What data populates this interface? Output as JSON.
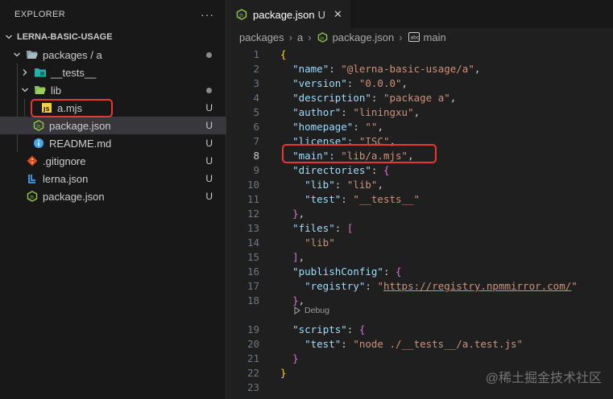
{
  "sidebar": {
    "title": "EXPLORER",
    "more": "···",
    "root": "LERNA-BASIC-USAGE",
    "items": [
      {
        "label": "packages / a",
        "status": ""
      },
      {
        "label": "__tests__",
        "status": ""
      },
      {
        "label": "lib",
        "status": ""
      },
      {
        "label": "a.mjs",
        "status": "U"
      },
      {
        "label": "package.json",
        "status": "U"
      },
      {
        "label": "README.md",
        "status": "U"
      },
      {
        "label": ".gitignore",
        "status": "U"
      },
      {
        "label": "lerna.json",
        "status": "U"
      },
      {
        "label": "package.json",
        "status": "U"
      }
    ]
  },
  "editor": {
    "tab": {
      "name": "package.json",
      "status": "U",
      "close": "✕"
    },
    "breadcrumbs": [
      "packages",
      "a",
      "package.json",
      "main"
    ],
    "codelens": "Debug",
    "active_line": "8",
    "lines": [
      {
        "n": "1",
        "t": "{"
      },
      {
        "n": "2",
        "t": "  \"name\": \"@lerna-basic-usage/a\","
      },
      {
        "n": "3",
        "t": "  \"version\": \"0.0.0\","
      },
      {
        "n": "4",
        "t": "  \"description\": \"package a\","
      },
      {
        "n": "5",
        "t": "  \"author\": \"liningxu\","
      },
      {
        "n": "6",
        "t": "  \"homepage\": \"\","
      },
      {
        "n": "7",
        "t": "  \"license\": \"ISC\","
      },
      {
        "n": "8",
        "t": "  \"main\": \"lib/a.mjs\","
      },
      {
        "n": "9",
        "t": "  \"directories\": {"
      },
      {
        "n": "10",
        "t": "    \"lib\": \"lib\","
      },
      {
        "n": "11",
        "t": "    \"test\": \"__tests__\""
      },
      {
        "n": "12",
        "t": "  },"
      },
      {
        "n": "13",
        "t": "  \"files\": ["
      },
      {
        "n": "14",
        "t": "    \"lib\""
      },
      {
        "n": "15",
        "t": "  ],"
      },
      {
        "n": "16",
        "t": "  \"publishConfig\": {"
      },
      {
        "n": "17",
        "t": "    \"registry\": \"https://registry.npmmirror.com/\""
      },
      {
        "n": "18",
        "t": "  },"
      },
      {
        "n": "19",
        "t": "  \"scripts\": {"
      },
      {
        "n": "20",
        "t": "    \"test\": \"node ./__tests__/a.test.js\""
      },
      {
        "n": "21",
        "t": "  }"
      },
      {
        "n": "22",
        "t": "}"
      },
      {
        "n": "23",
        "t": ""
      }
    ]
  },
  "watermark": "@稀土掘金技术社区",
  "colors": {
    "highlight_box": "#e53935",
    "json_key": "#9cdcfe",
    "json_string": "#ce9178",
    "selection_row": "#37373d"
  }
}
